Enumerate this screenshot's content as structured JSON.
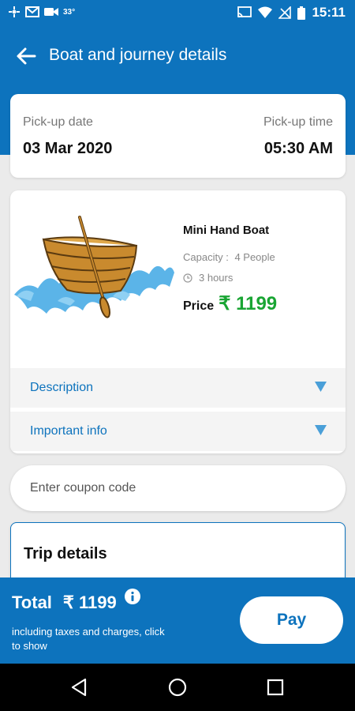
{
  "status_bar": {
    "temperature": "33°",
    "time": "15:11",
    "left_icons": [
      "grid-icon",
      "gmail-icon",
      "video-icon"
    ],
    "right_icons": [
      "cast-icon",
      "wifi-icon",
      "no-signal-icon",
      "battery-icon"
    ]
  },
  "header": {
    "title": "Boat and journey details"
  },
  "pickup": {
    "date_label": "Pick-up date",
    "date_value": "03 Mar 2020",
    "time_label": "Pick-up time",
    "time_value": "05:30 AM"
  },
  "boat": {
    "name": "Mini Hand Boat",
    "capacity_label": "Capacity :",
    "capacity_value": "4 People",
    "duration": "3 hours",
    "price_label": "Price",
    "price_value": "₹ 1199"
  },
  "accordions": [
    {
      "label": "Description"
    },
    {
      "label": "Important info"
    }
  ],
  "coupon": {
    "placeholder": "Enter coupon code",
    "value": ""
  },
  "trip": {
    "title": "Trip details"
  },
  "footer": {
    "total_label": "Total",
    "total_value": "₹ 1199",
    "note": "including taxes and charges, click to show",
    "pay_label": "Pay"
  },
  "colors": {
    "primary": "#0d73bd",
    "price_green": "#19a533",
    "background": "#ebebeb"
  }
}
